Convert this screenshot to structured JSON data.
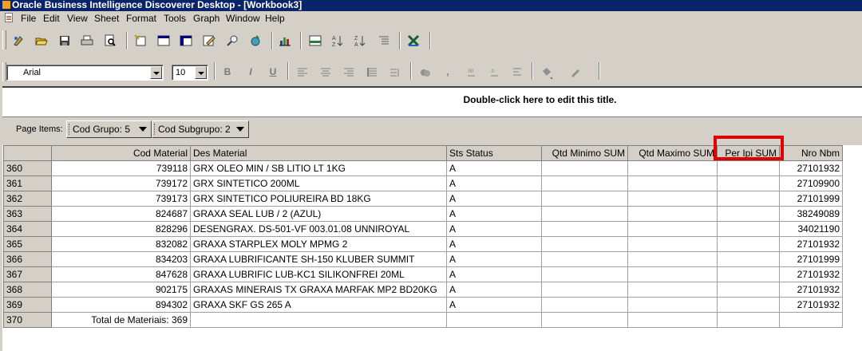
{
  "window": {
    "title": "Oracle Business Intelligence Discoverer Desktop - [Workbook3]"
  },
  "menu": [
    "File",
    "Edit",
    "View",
    "Sheet",
    "Format",
    "Tools",
    "Graph",
    "Window",
    "Help"
  ],
  "toolbar_icons": [
    "new-workbook-icon",
    "open-icon",
    "save-icon",
    "print-icon",
    "print-preview-icon",
    "new-sheet-wizard-icon",
    "table-icon",
    "crosstab-icon",
    "edit-sheet-icon",
    "find-icon",
    "refresh-icon",
    "graph-icon",
    "totals-icon",
    "sort-ascending-icon",
    "sort-descending-icon",
    "pivot-icon",
    "excel-export-icon"
  ],
  "format_toolbar": {
    "font": "Arial",
    "size": "10",
    "bold": "B",
    "italic": "I",
    "underline": "U",
    "comma": ","
  },
  "report": {
    "title": "Double-click here to edit this title."
  },
  "page_items": {
    "label": "Page Items:",
    "items": [
      {
        "label": "Cod Grupo: 5"
      },
      {
        "label": "Cod Subgrupo: 2"
      }
    ]
  },
  "table": {
    "columns": [
      "",
      "Cod Material",
      "Des Material",
      "Sts Status",
      "Qtd Minimo SUM",
      "Qtd Maximo SUM",
      "Per Ipi SUM",
      "Nro Nbm"
    ],
    "rows": [
      [
        "360",
        "739118",
        "GRX OLEO MIN / SB LITIO LT 1KG",
        "A",
        "",
        "",
        "",
        "27101932"
      ],
      [
        "361",
        "739172",
        "GRX SINTETICO 200ML",
        "A",
        "",
        "",
        "",
        "27109900"
      ],
      [
        "362",
        "739173",
        "GRX SINTETICO POLIUREIRA BD 18KG",
        "A",
        "",
        "",
        "",
        "27101999"
      ],
      [
        "363",
        "824687",
        "GRAXA SEAL LUB / 2 (AZUL)",
        "A",
        "",
        "",
        "",
        "38249089"
      ],
      [
        "364",
        "828296",
        "DESENGRAX. DS-501-VF 003.01.08 UNNIROYAL",
        "A",
        "",
        "",
        "",
        "34021190"
      ],
      [
        "365",
        "832082",
        "GRAXA STARPLEX MOLY MPMG 2",
        "A",
        "",
        "",
        "",
        "27101932"
      ],
      [
        "366",
        "834203",
        "GRAXA LUBRIFICANTE SH-150 KLUBER SUMMIT",
        "A",
        "",
        "",
        "",
        "27101999"
      ],
      [
        "367",
        "847628",
        "GRAXA LUBRIFIC LUB-KC1 SILIKONFREI 20ML",
        "A",
        "",
        "",
        "",
        "27101932"
      ],
      [
        "368",
        "902175",
        "GRAXAS MINERAIS TX GRAXA MARFAK MP2 BD20KG",
        "A",
        "",
        "",
        "",
        "27101932"
      ],
      [
        "369",
        "894302",
        "GRAXA SKF GS 265 A",
        "A",
        "",
        "",
        "",
        "27101932"
      ],
      [
        "370",
        "Total de Materiais: 369",
        "",
        "",
        "",
        "",
        "",
        ""
      ]
    ]
  }
}
